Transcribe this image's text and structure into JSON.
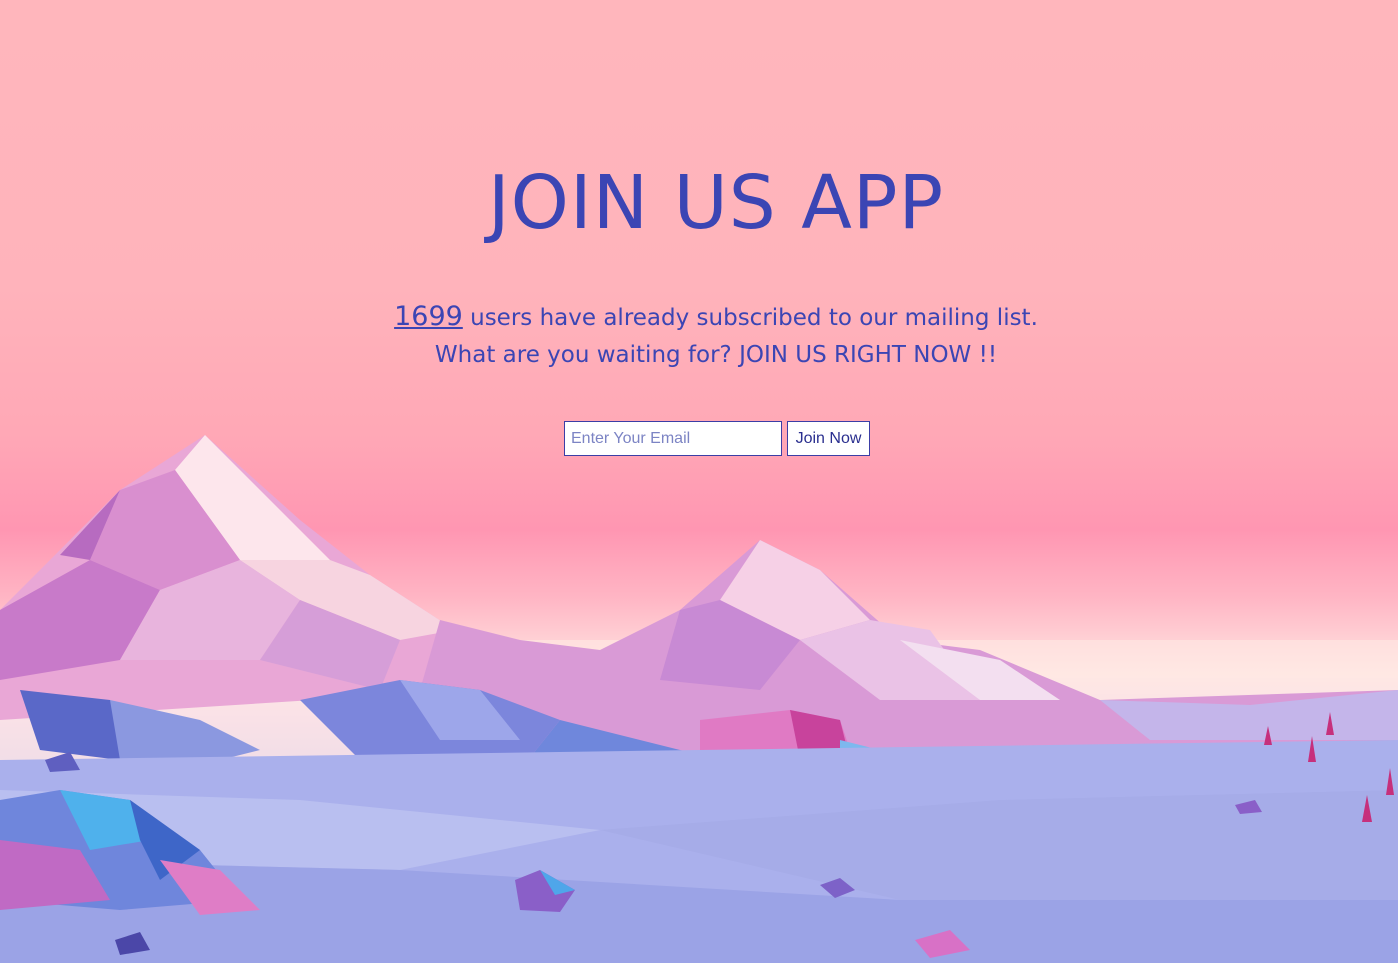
{
  "header": {
    "title": "JOIN US APP"
  },
  "subscribers": {
    "count": "1699",
    "line1_suffix": " users have already subscribed to our mailing list.",
    "line2": "What are you waiting for? JOIN US RIGHT NOW !!"
  },
  "signup_form": {
    "email_placeholder": "Enter Your Email",
    "email_value": "",
    "submit_label": "Join Now"
  },
  "colors": {
    "text_accent": "#3b45b4",
    "sky_top": "#ffb6bc",
    "sky_horizon": "#ffe6e2",
    "ground": "#9fa7ea"
  }
}
